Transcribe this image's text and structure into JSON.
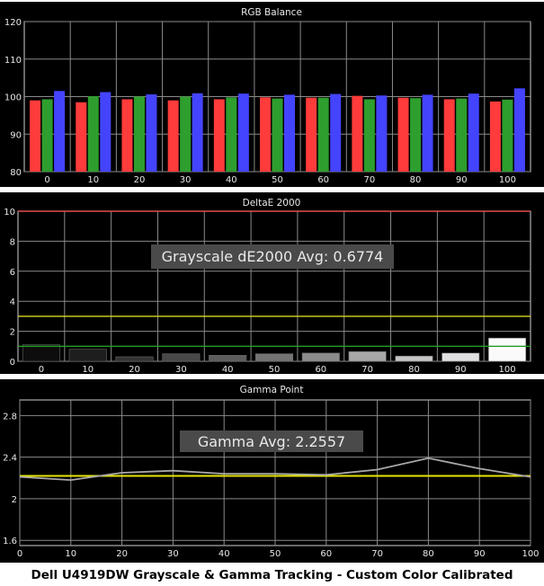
{
  "caption": "Dell U4919DW Grayscale & Gamma Tracking - Custom Color Calibrated",
  "chart_data": [
    {
      "type": "bar",
      "title": "RGB Balance",
      "categories": [
        "0",
        "10",
        "20",
        "30",
        "40",
        "50",
        "60",
        "70",
        "80",
        "90",
        "100"
      ],
      "ylim": [
        80,
        120
      ],
      "yticks": [
        80,
        90,
        100,
        110,
        120
      ],
      "grid": true,
      "series": [
        {
          "color": "#ff3b3b",
          "values": [
            99.0,
            98.5,
            99.3,
            99.0,
            99.3,
            99.8,
            99.7,
            100.2,
            99.7,
            99.3,
            98.7
          ]
        },
        {
          "color": "#2e9e2e",
          "values": [
            99.3,
            100.1,
            100.0,
            100.0,
            99.8,
            99.5,
            99.7,
            99.3,
            99.6,
            99.5,
            99.2
          ]
        },
        {
          "color": "#4444ff",
          "values": [
            101.5,
            101.2,
            100.6,
            100.9,
            100.8,
            100.5,
            100.7,
            100.3,
            100.5,
            100.8,
            102.2
          ]
        }
      ]
    },
    {
      "type": "bar",
      "title": "DeltaE 2000",
      "categories": [
        "0",
        "10",
        "20",
        "30",
        "40",
        "50",
        "60",
        "70",
        "80",
        "90",
        "100"
      ],
      "ylim": [
        0,
        10
      ],
      "yticks": [
        0,
        2,
        4,
        6,
        8,
        10
      ],
      "grid": true,
      "values": [
        1.1,
        0.8,
        0.3,
        0.5,
        0.4,
        0.5,
        0.55,
        0.65,
        0.35,
        0.55,
        1.55
      ],
      "bar_colors": [
        "#0d0d0d",
        "#1e1e1e",
        "#333333",
        "#484848",
        "#5c5c5c",
        "#737373",
        "#8c8c8c",
        "#a8a8a8",
        "#c6c6c6",
        "#e2e2e2",
        "#fafafa"
      ],
      "reference_lines": [
        {
          "value": 10,
          "color": "#e05050"
        },
        {
          "value": 3,
          "color": "#d8d820"
        },
        {
          "value": 1,
          "color": "#20a020"
        }
      ],
      "annotation": "Grayscale dE2000 Avg: 0.6774"
    },
    {
      "type": "line",
      "title": "Gamma Point",
      "x": [
        0,
        10,
        20,
        30,
        40,
        50,
        60,
        70,
        80,
        90,
        100
      ],
      "xticks": [
        0,
        10,
        20,
        30,
        40,
        50,
        60,
        70,
        80,
        90,
        100
      ],
      "ylim": [
        1.55,
        2.95
      ],
      "yticks": [
        1.6,
        2.0,
        2.4,
        2.8
      ],
      "ytick_labels": [
        "1.6",
        "2",
        "2.4",
        "2.8"
      ],
      "grid": true,
      "series": [
        {
          "color": "#a8a8a8",
          "values": [
            2.21,
            2.18,
            2.25,
            2.27,
            2.24,
            2.24,
            2.23,
            2.28,
            2.39,
            2.29,
            2.21
          ]
        }
      ],
      "target": {
        "value": 2.22,
        "color": "#e6e600"
      },
      "annotation": "Gamma Avg: 2.2557"
    }
  ]
}
